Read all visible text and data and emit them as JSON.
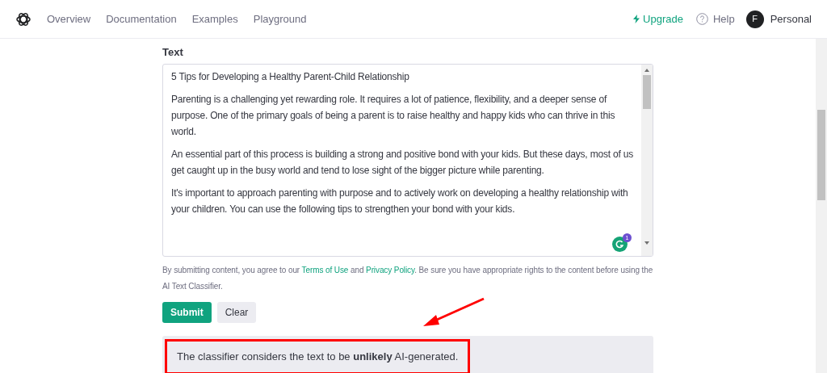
{
  "nav": {
    "links": [
      {
        "label": "Overview"
      },
      {
        "label": "Documentation"
      },
      {
        "label": "Examples"
      },
      {
        "label": "Playground"
      }
    ],
    "upgrade": "Upgrade",
    "help": "Help",
    "avatar": "F",
    "account": "Personal"
  },
  "form": {
    "label": "Text",
    "paragraphs": [
      "5 Tips for Developing a Healthy Parent-Child Relationship",
      "Parenting is a challenging yet rewarding role. It requires a lot of patience, flexibility, and a deeper sense of purpose. One of the primary goals of being a parent is to raise healthy and happy kids who can thrive in this world.",
      "An essential part of this process is building a strong and positive bond with your kids. But these days, most of us get caught up in the busy world and tend to lose sight of the bigger picture while parenting.",
      "It's important to approach parenting with purpose and to actively work on developing a healthy relationship with your children. You can use the following tips to strengthen your bond with your kids."
    ],
    "grammar_badge_count": "1",
    "disclaimer": {
      "before": "By submitting content, you agree to our",
      "link_1": "Terms of Use",
      "middle": "and",
      "link_2": "Privacy Policy",
      "after": ". Be sure you have appropriate rights to the content before using the AI Text Classifier."
    },
    "buttons": [
      {
        "label": "Submit",
        "kind": "primary"
      },
      {
        "label": "Clear",
        "kind": "secondary"
      }
    ],
    "result": "The classifier considers the text to be **unlikely** AI-generated."
  }
}
